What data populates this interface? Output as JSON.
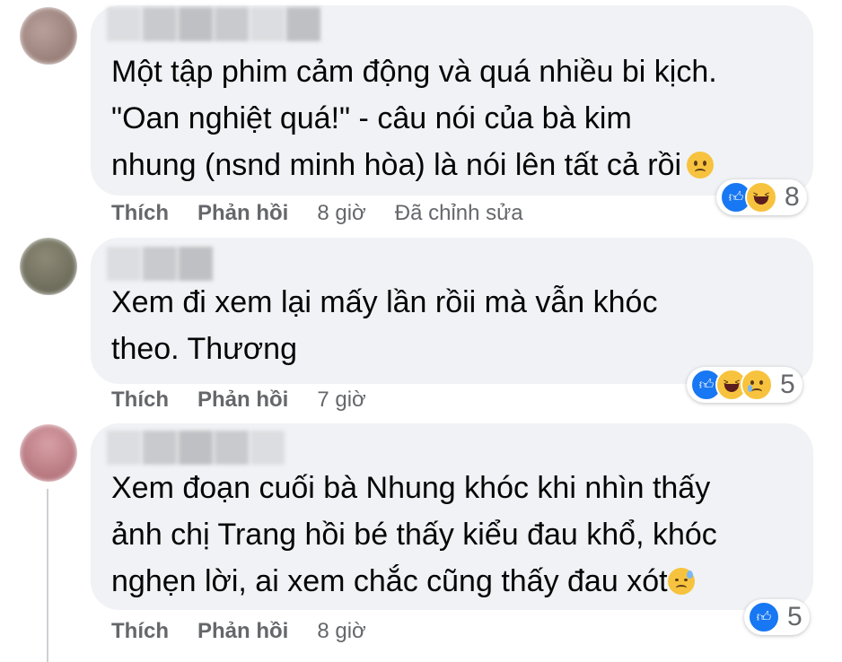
{
  "colors": {
    "bubble": "#f0f2f5",
    "text": "#050505",
    "secondary": "#65676b",
    "like_blue": "#1877f2",
    "emoji_yellow": "#f7c33e"
  },
  "comments": [
    {
      "text_lines": [
        "Một tập phim cảm động và quá nhiều bi kịch.",
        "\"Oan nghiệt quá!\" - câu nói của bà kim",
        "nhung (nsnd minh hòa) là nói lên tất cả rồi"
      ],
      "trailing_emoji": "frowning-face",
      "reactions": [
        "like",
        "haha"
      ],
      "reaction_count": "8",
      "like_label": "Thích",
      "reply_label": "Phản hồi",
      "time": "8 giờ",
      "edited_label": "Đã chỉnh sửa"
    },
    {
      "text_lines": [
        "Xem đi xem lại mấy lần rồii mà vẫn khóc",
        "theo. Thương"
      ],
      "reactions": [
        "like",
        "haha",
        "sad"
      ],
      "reaction_count": "5",
      "like_label": "Thích",
      "reply_label": "Phản hồi",
      "time": "7 giờ"
    },
    {
      "text_lines": [
        "Xem đoạn cuối bà Nhung khóc khi nhìn thấy",
        "ảnh chị Trang hồi bé thấy kiểu đau khổ, khóc",
        "nghẹn lời, ai xem chắc cũng thấy đau xót"
      ],
      "trailing_emoji": "downcast-face-with-sweat",
      "reactions": [
        "like"
      ],
      "reaction_count": "5",
      "like_label": "Thích",
      "reply_label": "Phản hồi",
      "time": "8 giờ"
    }
  ]
}
